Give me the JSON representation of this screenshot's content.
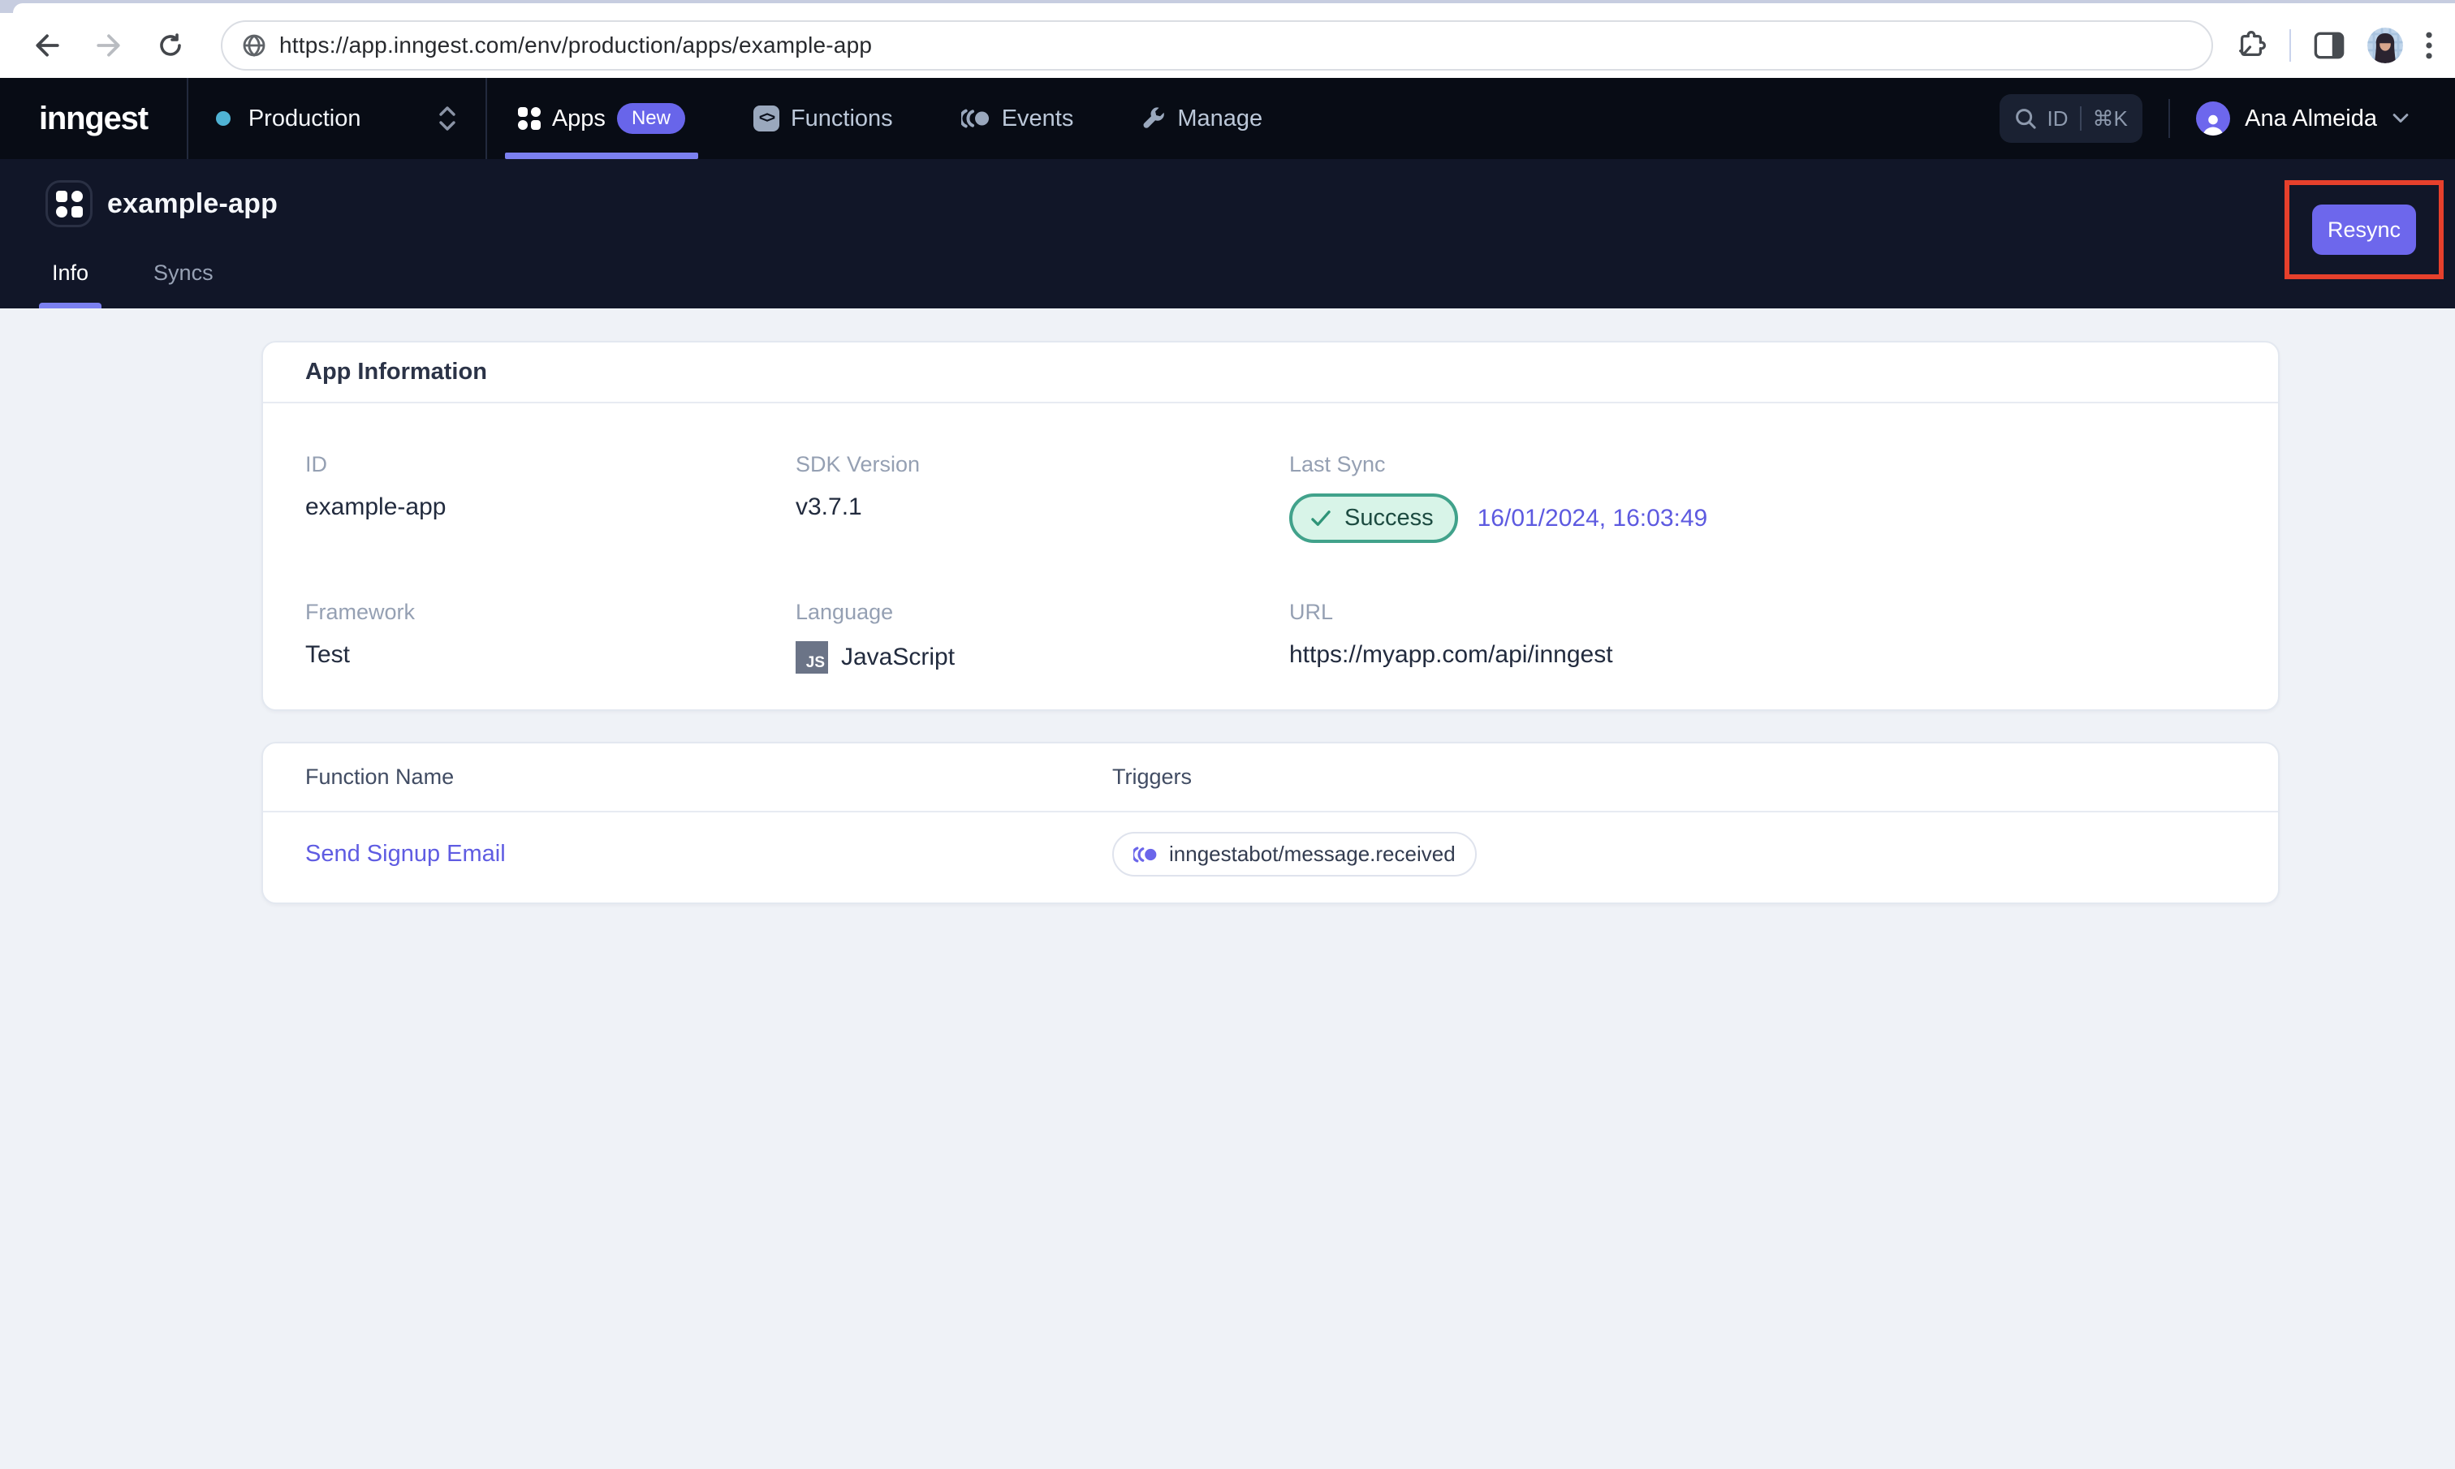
{
  "browser": {
    "url": "https://app.inngest.com/env/production/apps/example-app",
    "icons": [
      "back-arrow",
      "forward-arrow",
      "reload",
      "globe",
      "extensions",
      "side-panel",
      "profile-avatar",
      "kebab-menu"
    ]
  },
  "navbar": {
    "logo": "inngest",
    "env_selector": {
      "label": "Production",
      "dot_color": "#4FB3D4",
      "icon": "updown-chevrons"
    },
    "items": [
      {
        "label": "Apps",
        "icon": "grid-icon",
        "badge": "New",
        "active": true
      },
      {
        "label": "Functions",
        "icon": "code-icon",
        "active": false
      },
      {
        "label": "Events",
        "icon": "events-icon",
        "active": false
      },
      {
        "label": "Manage",
        "icon": "wrench-icon",
        "active": false
      }
    ],
    "search": {
      "icon": "search-icon",
      "label": "ID",
      "shortcut": "⌘K"
    },
    "user": {
      "name": "Ana Almeida",
      "icon": "person-icon"
    },
    "accent_underline": "#7B80F0",
    "badge_color": "#6865EA"
  },
  "header": {
    "app_name": "example-app",
    "icon": "app-grid-icon",
    "tabs": [
      {
        "label": "Info",
        "active": true
      },
      {
        "label": "Syncs",
        "active": false
      }
    ],
    "resync_label": "Resync",
    "annotation_color": "#E6402C",
    "button_color": "#6D67EC"
  },
  "app_info": {
    "title": "App Information",
    "fields": [
      {
        "label": "ID",
        "value": "example-app"
      },
      {
        "label": "SDK Version",
        "value": "v3.7.1"
      },
      {
        "label": "Last Sync",
        "status": "Success",
        "status_icon": "check-icon",
        "timestamp": "16/01/2024, 16:03:49",
        "status_colors": {
          "bg": "#D8F4E8",
          "border": "#41A28B",
          "text": "#1D4B41"
        }
      },
      {
        "label": "Framework",
        "value": "Test"
      },
      {
        "label": "Language",
        "value": "JavaScript",
        "chip": "JS"
      },
      {
        "label": "URL",
        "value": "https://myapp.com/api/inngest"
      }
    ]
  },
  "functions_table": {
    "columns": [
      "Function Name",
      "Triggers"
    ],
    "rows": [
      {
        "name": "Send Signup Email",
        "trigger": "inngestabot/message.received",
        "trigger_icon": "events-icon"
      }
    ]
  }
}
